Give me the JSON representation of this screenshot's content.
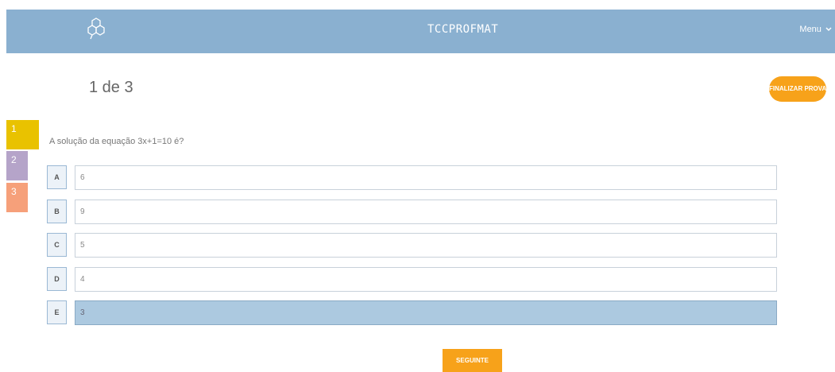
{
  "header": {
    "title": "TCCPROFMAT",
    "menu_label": "Menu",
    "logo_icon": "molecule-icon",
    "menu_icon": "chevron-down-icon",
    "background": "#8ab0d0"
  },
  "progress": {
    "label": "1 de 3"
  },
  "finish_button": {
    "label": "FINALIZAR PROVA",
    "color": "#f7a21a"
  },
  "question_nav": [
    {
      "label": "1",
      "color": "#e9c200"
    },
    {
      "label": "2",
      "color": "#b5a4c9"
    },
    {
      "label": "3",
      "color": "#f6a07a"
    }
  ],
  "question": {
    "text": "A solução da equação 3x+1=10 é?"
  },
  "options": [
    {
      "letter": "A",
      "text": "6"
    },
    {
      "letter": "B",
      "text": "9"
    },
    {
      "letter": "C",
      "text": "5"
    },
    {
      "letter": "D",
      "text": "4"
    },
    {
      "letter": "E",
      "text": "3"
    }
  ],
  "selected_option": "E",
  "next_button": {
    "label": "SEGUINTE"
  }
}
